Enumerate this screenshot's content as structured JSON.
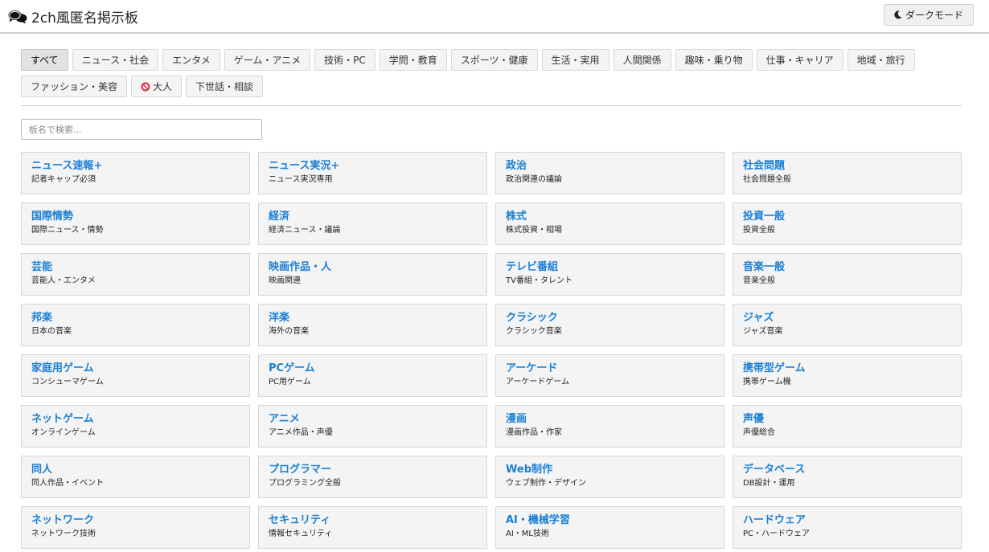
{
  "header": {
    "title": "2ch風匿名掲示板",
    "dark_mode_label": "ダークモード"
  },
  "categories": [
    {
      "label": "すべて",
      "active": true
    },
    {
      "label": "ニュース・社会"
    },
    {
      "label": "エンタメ"
    },
    {
      "label": "ゲーム・アニメ"
    },
    {
      "label": "技術・PC"
    },
    {
      "label": "学問・教育"
    },
    {
      "label": "スポーツ・健康"
    },
    {
      "label": "生活・実用"
    },
    {
      "label": "人間関係"
    },
    {
      "label": "趣味・乗り物"
    },
    {
      "label": "仕事・キャリア"
    },
    {
      "label": "地域・旅行"
    },
    {
      "label": "ファッション・美容"
    },
    {
      "label": "大人",
      "icon": "no-entry-icon"
    },
    {
      "label": "下世話・相談"
    }
  ],
  "search": {
    "placeholder": "板名で検索..."
  },
  "boards": [
    {
      "name": "ニュース速報+",
      "desc": "記者キャップ必須"
    },
    {
      "name": "ニュース実況+",
      "desc": "ニュース実況専用"
    },
    {
      "name": "政治",
      "desc": "政治関連の議論"
    },
    {
      "name": "社会問題",
      "desc": "社会問題全般"
    },
    {
      "name": "国際情勢",
      "desc": "国際ニュース・情勢"
    },
    {
      "name": "経済",
      "desc": "経済ニュース・議論"
    },
    {
      "name": "株式",
      "desc": "株式投資・相場"
    },
    {
      "name": "投資一般",
      "desc": "投資全般"
    },
    {
      "name": "芸能",
      "desc": "芸能人・エンタメ"
    },
    {
      "name": "映画作品・人",
      "desc": "映画関連"
    },
    {
      "name": "テレビ番組",
      "desc": "TV番組・タレント"
    },
    {
      "name": "音楽一般",
      "desc": "音楽全般"
    },
    {
      "name": "邦楽",
      "desc": "日本の音楽"
    },
    {
      "name": "洋楽",
      "desc": "海外の音楽"
    },
    {
      "name": "クラシック",
      "desc": "クラシック音楽"
    },
    {
      "name": "ジャズ",
      "desc": "ジャズ音楽"
    },
    {
      "name": "家庭用ゲーム",
      "desc": "コンシューマゲーム"
    },
    {
      "name": "PCゲーム",
      "desc": "PC用ゲーム"
    },
    {
      "name": "アーケード",
      "desc": "アーケードゲーム"
    },
    {
      "name": "携帯型ゲーム",
      "desc": "携帯ゲーム機"
    },
    {
      "name": "ネットゲーム",
      "desc": "オンラインゲーム"
    },
    {
      "name": "アニメ",
      "desc": "アニメ作品・声優"
    },
    {
      "name": "漫画",
      "desc": "漫画作品・作家"
    },
    {
      "name": "声優",
      "desc": "声優総合"
    },
    {
      "name": "同人",
      "desc": "同人作品・イベント"
    },
    {
      "name": "プログラマー",
      "desc": "プログラミング全般"
    },
    {
      "name": "Web制作",
      "desc": "ウェブ制作・デザイン"
    },
    {
      "name": "データベース",
      "desc": "DB設計・運用"
    },
    {
      "name": "ネットワーク",
      "desc": "ネットワーク技術"
    },
    {
      "name": "セキュリティ",
      "desc": "情報セキュリティ"
    },
    {
      "name": "AI・機械学習",
      "desc": "AI・ML技術"
    },
    {
      "name": "ハードウェア",
      "desc": "PC・ハードウェア"
    }
  ],
  "colors": {
    "board_link": "#1a7fd4",
    "card_bg": "#f4f4f4",
    "border": "#d6d6d6"
  }
}
